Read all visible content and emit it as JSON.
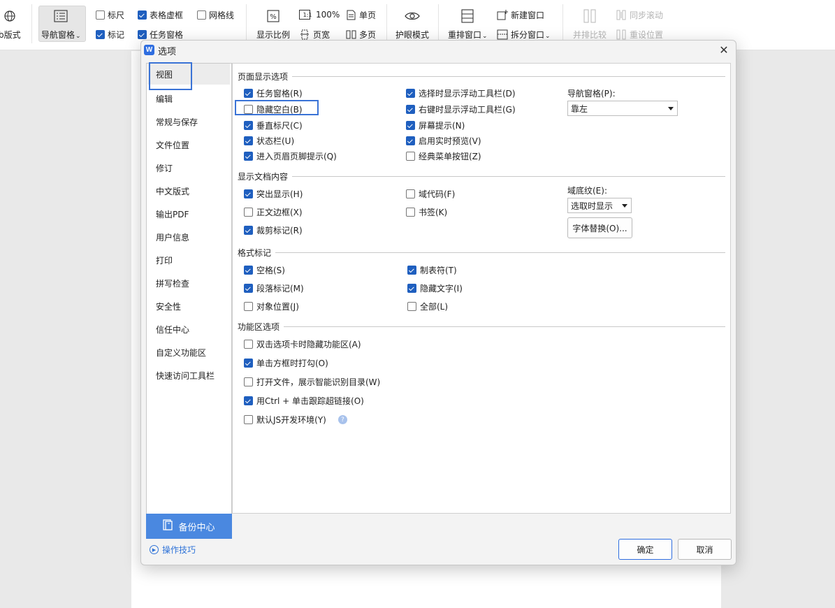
{
  "ribbon": {
    "web_layout": "b版式",
    "nav_pane": "导航窗格",
    "ruler": "标尺",
    "table_gridlines": "表格虚框",
    "gridlines": "网格线",
    "marks": "标记",
    "task_pane": "任务窗格",
    "zoom_ratio": "显示比例",
    "one_to_one": "1:1",
    "zoom_100": "100%",
    "single_page": "单页",
    "page_width": "页宽",
    "multi_page": "多页",
    "eye_protect": "护眼模式",
    "new_window": "新建窗口",
    "rearrange_window": "重排窗口",
    "split_window": "拆分窗口",
    "side_by_side": "并排比较",
    "sync_scroll": "同步滚动",
    "reset_position": "重设位置",
    "checks": {
      "ruler": false,
      "table_gridlines": true,
      "gridlines": false,
      "marks": true,
      "task_pane": true
    }
  },
  "dialog": {
    "title": "选项",
    "nav": [
      "视图",
      "编辑",
      "常规与保存",
      "文件位置",
      "修订",
      "中文版式",
      "输出PDF",
      "用户信息",
      "打印",
      "拼写检查",
      "安全性",
      "信任中心",
      "自定义功能区",
      "快速访问工具栏"
    ],
    "backup_center": "备份中心",
    "tips": "操作技巧",
    "ok": "确定",
    "cancel": "取消"
  },
  "view": {
    "page_display": {
      "title": "页面显示选项",
      "task_pane": {
        "label": "任务窗格(R)",
        "checked": true
      },
      "hide_blank": {
        "label": "隐藏空白(B)",
        "checked": false
      },
      "vertical_ruler": {
        "label": "垂直标尺(C)",
        "checked": true
      },
      "status_bar": {
        "label": "状态栏(U)",
        "checked": true
      },
      "header_footer_hint": {
        "label": "进入页眉页脚提示(Q)",
        "checked": true
      },
      "float_toolbar_select": {
        "label": "选择时显示浮动工具栏(D)",
        "checked": true
      },
      "float_toolbar_right": {
        "label": "右键时显示浮动工具栏(G)",
        "checked": true
      },
      "screen_tips": {
        "label": "屏幕提示(N)",
        "checked": true
      },
      "live_preview": {
        "label": "启用实时预览(V)",
        "checked": true
      },
      "classic_menu": {
        "label": "经典菜单按钮(Z)",
        "checked": false
      },
      "nav_pane_label": "导航窗格(P):",
      "nav_pane_value": "靠左"
    },
    "doc_content": {
      "title": "显示文档内容",
      "highlight": {
        "label": "突出显示(H)",
        "checked": true
      },
      "text_boundaries": {
        "label": "正文边框(X)",
        "checked": false
      },
      "crop_marks": {
        "label": "裁剪标记(R)",
        "checked": true
      },
      "field_codes": {
        "label": "域代码(F)",
        "checked": false
      },
      "bookmarks": {
        "label": "书签(K)",
        "checked": false
      },
      "field_shading_label": "域底纹(E):",
      "field_shading_value": "选取时显示",
      "font_substitution": "字体替换(O)..."
    },
    "format_marks": {
      "title": "格式标记",
      "spaces": {
        "label": "空格(S)",
        "checked": true
      },
      "paragraph_marks": {
        "label": "段落标记(M)",
        "checked": true
      },
      "object_anchors": {
        "label": "对象位置(J)",
        "checked": false
      },
      "tabs": {
        "label": "制表符(T)",
        "checked": true
      },
      "hidden_text": {
        "label": "隐藏文字(I)",
        "checked": true
      },
      "all": {
        "label": "全部(L)",
        "checked": false
      }
    },
    "ribbon_options": {
      "title": "功能区选项",
      "dblclick_hide": {
        "label": "双击选项卡时隐藏功能区(A)",
        "checked": false
      },
      "click_check": {
        "label": "单击方框时打勾(O)",
        "checked": true
      },
      "smart_toc": {
        "label": "打开文件，展示智能识别目录(W)",
        "checked": false
      },
      "ctrl_click_link": {
        "label": "用Ctrl + 单击跟踪超链接(O)",
        "checked": true
      },
      "js_env": {
        "label": "默认JS开发环境(Y)",
        "checked": false
      }
    }
  }
}
